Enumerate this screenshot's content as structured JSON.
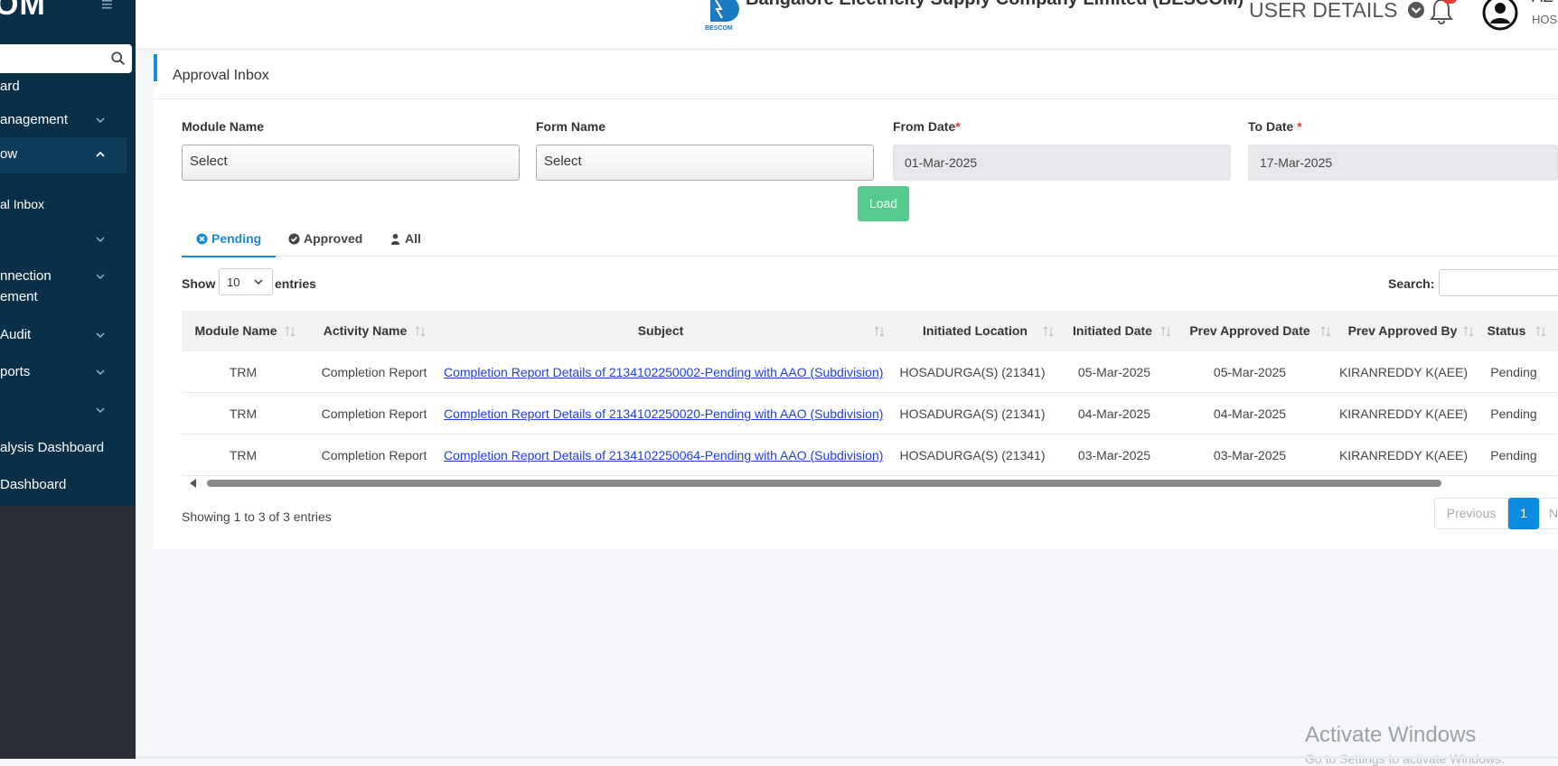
{
  "sidebar": {
    "brand": "OM",
    "items": [
      {
        "label": "ard"
      },
      {
        "label": "anagement"
      },
      {
        "label": "ow"
      },
      {
        "label": "al Inbox"
      },
      {
        "label": ""
      },
      {
        "label": "nnection"
      },
      {
        "label": "ement"
      },
      {
        "label": "Audit"
      },
      {
        "label": "ports"
      },
      {
        "label": ""
      },
      {
        "label": "alysis Dashboard"
      },
      {
        "label": "Dashboard"
      }
    ]
  },
  "header": {
    "company": "Bangalore Electricity Supply Company Limited (BESCOM)",
    "logo_text": "BESCOM",
    "user_details": "USER DETAILS",
    "user_name": "AE",
    "user_location": "HOS"
  },
  "card": {
    "title": "Approval Inbox",
    "filters": {
      "module_label": "Module Name",
      "module_value": "Select",
      "form_label": "Form Name",
      "form_value": "Select",
      "from_label": "From Date",
      "from_value": "01-Mar-2025",
      "to_label": "To Date",
      "to_value": "17-Mar-2025",
      "required_mark": "*"
    },
    "load_label": "Load",
    "tabs": [
      "Pending",
      "Approved",
      "All"
    ],
    "show_label": "Show",
    "show_value": "10",
    "entries_label": "entries",
    "search_label": "Search:",
    "table": {
      "headers": [
        "Module Name",
        "Activity Name",
        "Subject",
        "Initiated Location",
        "Initiated Date",
        "Prev Approved Date",
        "Prev Approved By",
        "Status"
      ],
      "rows": [
        [
          "TRM",
          "Completion Report",
          "Completion Report Details of 2134102250002-Pending with AAO (Subdivision)",
          "HOSADURGA(S) (21341)",
          "05-Mar-2025",
          "05-Mar-2025",
          "KIRANREDDY K(AEE)",
          "Pending"
        ],
        [
          "TRM",
          "Completion Report",
          "Completion Report Details of 2134102250020-Pending with AAO (Subdivision)",
          "HOSADURGA(S) (21341)",
          "04-Mar-2025",
          "04-Mar-2025",
          "KIRANREDDY K(AEE)",
          "Pending"
        ],
        [
          "TRM",
          "Completion Report",
          "Completion Report Details of 2134102250064-Pending with AAO (Subdivision)",
          "HOSADURGA(S) (21341)",
          "03-Mar-2025",
          "03-Mar-2025",
          "KIRANREDDY K(AEE)",
          "Pending"
        ]
      ]
    },
    "info": "Showing 1 to 3 of 3 entries",
    "pager": {
      "prev": "Previous",
      "current": "1",
      "next": "Ne"
    }
  },
  "watermark": {
    "title": "Activate Windows",
    "subtitle": "Go to Settings to activate Windows."
  },
  "colors": {
    "sidebar": "#0a3049",
    "accent": "#1a8ad4",
    "load": "#55ca8c",
    "link": "#1f3fd8"
  }
}
